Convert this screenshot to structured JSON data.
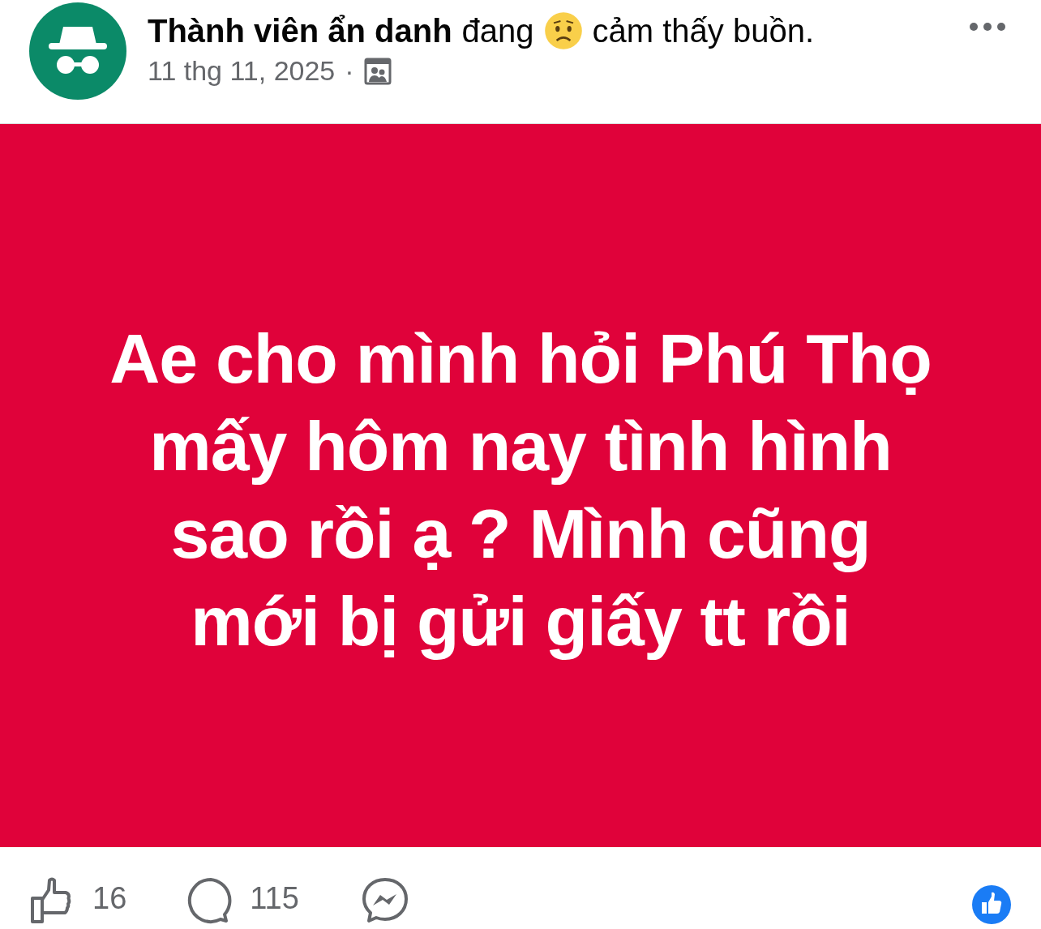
{
  "post": {
    "author": "Thành viên ẩn danh",
    "verb": "đang",
    "feeling": "cảm thấy buồn.",
    "date": "11 thg 11, 2025",
    "separator": "·"
  },
  "content": {
    "text": "Ae cho mình hỏi Phú Thọ\nmấy hôm nay tình hình\nsao rồi ạ ? Mình cũng\nmới bị gửi giấy tt rồi"
  },
  "footer": {
    "likes": "16",
    "comments": "115"
  }
}
